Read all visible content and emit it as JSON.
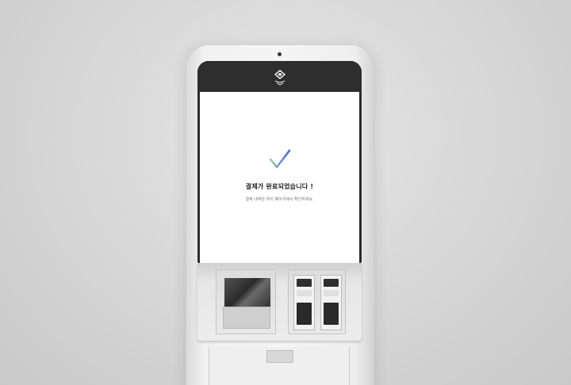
{
  "screen": {
    "message_title": "결제가 완료되었습니다 !",
    "message_subtitle": "결제 내역은 마이 페이지에서 확인하세요."
  },
  "icons": {
    "logo": "brand-logo-icon",
    "success": "checkmark-icon"
  },
  "colors": {
    "background": "#d6d6d6",
    "header": "#2e2e2e",
    "screen": "#ffffff",
    "check_gradient_start": "#9bd3a6",
    "check_gradient_end": "#4a5fd8"
  }
}
